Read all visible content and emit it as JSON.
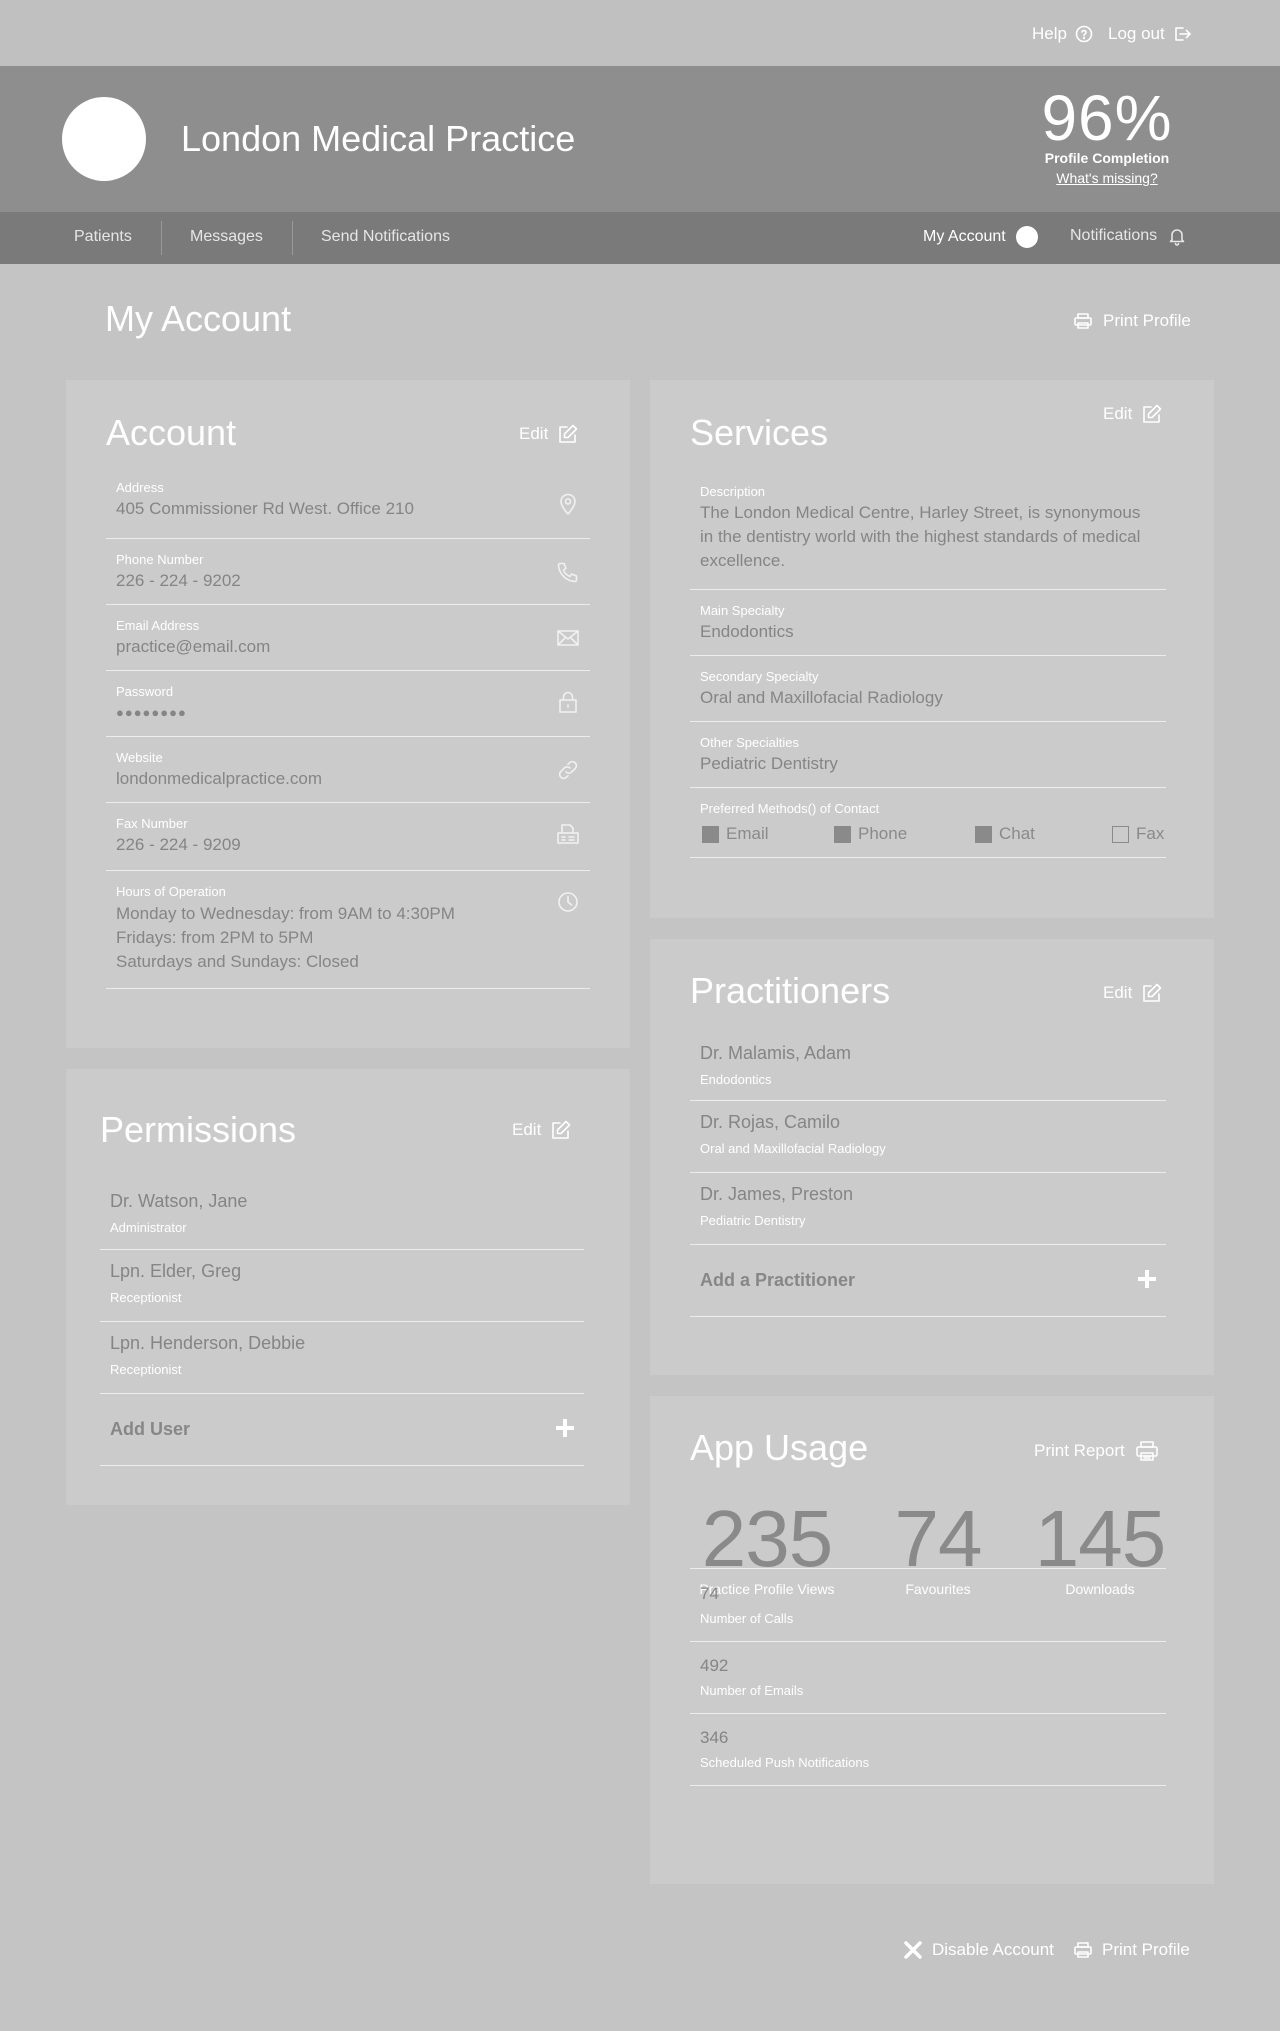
{
  "topbar": {
    "help_label": "Help",
    "logout_label": "Log out"
  },
  "header": {
    "practice_name": "London Medical Practice",
    "completion_percent": "96%",
    "completion_label": "Profile Completion",
    "whats_missing": "What's missing?"
  },
  "nav": {
    "items": [
      "Patients",
      "Messages",
      "Send Notifications"
    ],
    "my_account": "My Account",
    "notifications": "Notifications"
  },
  "page": {
    "title": "My Account",
    "print_profile": "Print Profile"
  },
  "account": {
    "title": "Account",
    "edit": "Edit",
    "fields": [
      {
        "label": "Address",
        "value": "405 Commissioner Rd West. Office 210",
        "icon": "location-pin-icon"
      },
      {
        "label": "Phone Number",
        "value": "226 - 224 - 9202",
        "icon": "phone-icon"
      },
      {
        "label": "Email Address",
        "value": "practice@email.com",
        "icon": "envelope-icon"
      },
      {
        "label": "Password",
        "value": "●●●●●●●●",
        "icon": "lock-icon"
      },
      {
        "label": "Website",
        "value": "londonmedicalpractice.com",
        "icon": "link-icon"
      },
      {
        "label": "Fax Number",
        "value": "226 - 224 - 9209",
        "icon": "fax-icon"
      },
      {
        "label": "Hours of Operation",
        "value_lines": [
          "Monday to Wednesday: from 9AM to 4:30PM",
          "Fridays: from 2PM to 5PM",
          "Saturdays and Sundays: Closed"
        ],
        "icon": "clock-icon"
      }
    ]
  },
  "permissions": {
    "title": "Permissions",
    "edit": "Edit",
    "users": [
      {
        "name": "Dr. Watson, Jane",
        "role": "Administrator"
      },
      {
        "name": "Lpn. Elder, Greg",
        "role": "Receptionist"
      },
      {
        "name": "Lpn. Henderson, Debbie",
        "role": "Receptionist"
      }
    ],
    "add_label": "Add User"
  },
  "services": {
    "title": "Services",
    "edit": "Edit",
    "description_label": "Description",
    "description_lines": [
      "The London Medical Centre, Harley Street, is synonymous",
      "in the dentistry world with the highest standards of medical",
      "excellence."
    ],
    "main_specialty_label": "Main Specialty",
    "main_specialty": "Endodontics",
    "secondary_specialty_label": "Secondary Specialty",
    "secondary_specialty": "Oral and Maxillofacial Radiology",
    "other_specialties_label": "Other Specialties",
    "other_specialties": "Pediatric Dentistry",
    "contact_label": "Preferred Methods() of Contact",
    "contact_methods": [
      {
        "label": "Email",
        "checked": true
      },
      {
        "label": "Phone",
        "checked": true
      },
      {
        "label": "Chat",
        "checked": true
      },
      {
        "label": "Fax",
        "checked": false
      }
    ]
  },
  "practitioners": {
    "title": "Practitioners",
    "edit": "Edit",
    "list": [
      {
        "name": "Dr. Malamis, Adam",
        "specialty": "Endodontics"
      },
      {
        "name": "Dr. Rojas, Camilo",
        "specialty": "Oral and Maxillofacial Radiology"
      },
      {
        "name": "Dr. James, Preston",
        "specialty": "Pediatric Dentistry"
      }
    ],
    "add_label": "Add a Practitioner"
  },
  "app_usage": {
    "title": "App Usage",
    "print_report": "Print Report",
    "big_stats": [
      {
        "value": "235",
        "label": "Practice Profile Views"
      },
      {
        "value": "74",
        "label": "Favourites"
      },
      {
        "value": "145",
        "label": "Downloads"
      }
    ],
    "rows": [
      {
        "value": "74",
        "label": "Number of Calls"
      },
      {
        "value": "492",
        "label": "Number of Emails"
      },
      {
        "value": "346",
        "label": "Scheduled Push Notifications"
      }
    ]
  },
  "footer": {
    "disable_account": "Disable Account",
    "print_profile": "Print Profile"
  },
  "colors": {
    "background": "#c4c4c4",
    "header": "#8e8e8e",
    "nav": "#7a7a7a",
    "card": "#cbcbcb",
    "value_text": "#858585"
  }
}
